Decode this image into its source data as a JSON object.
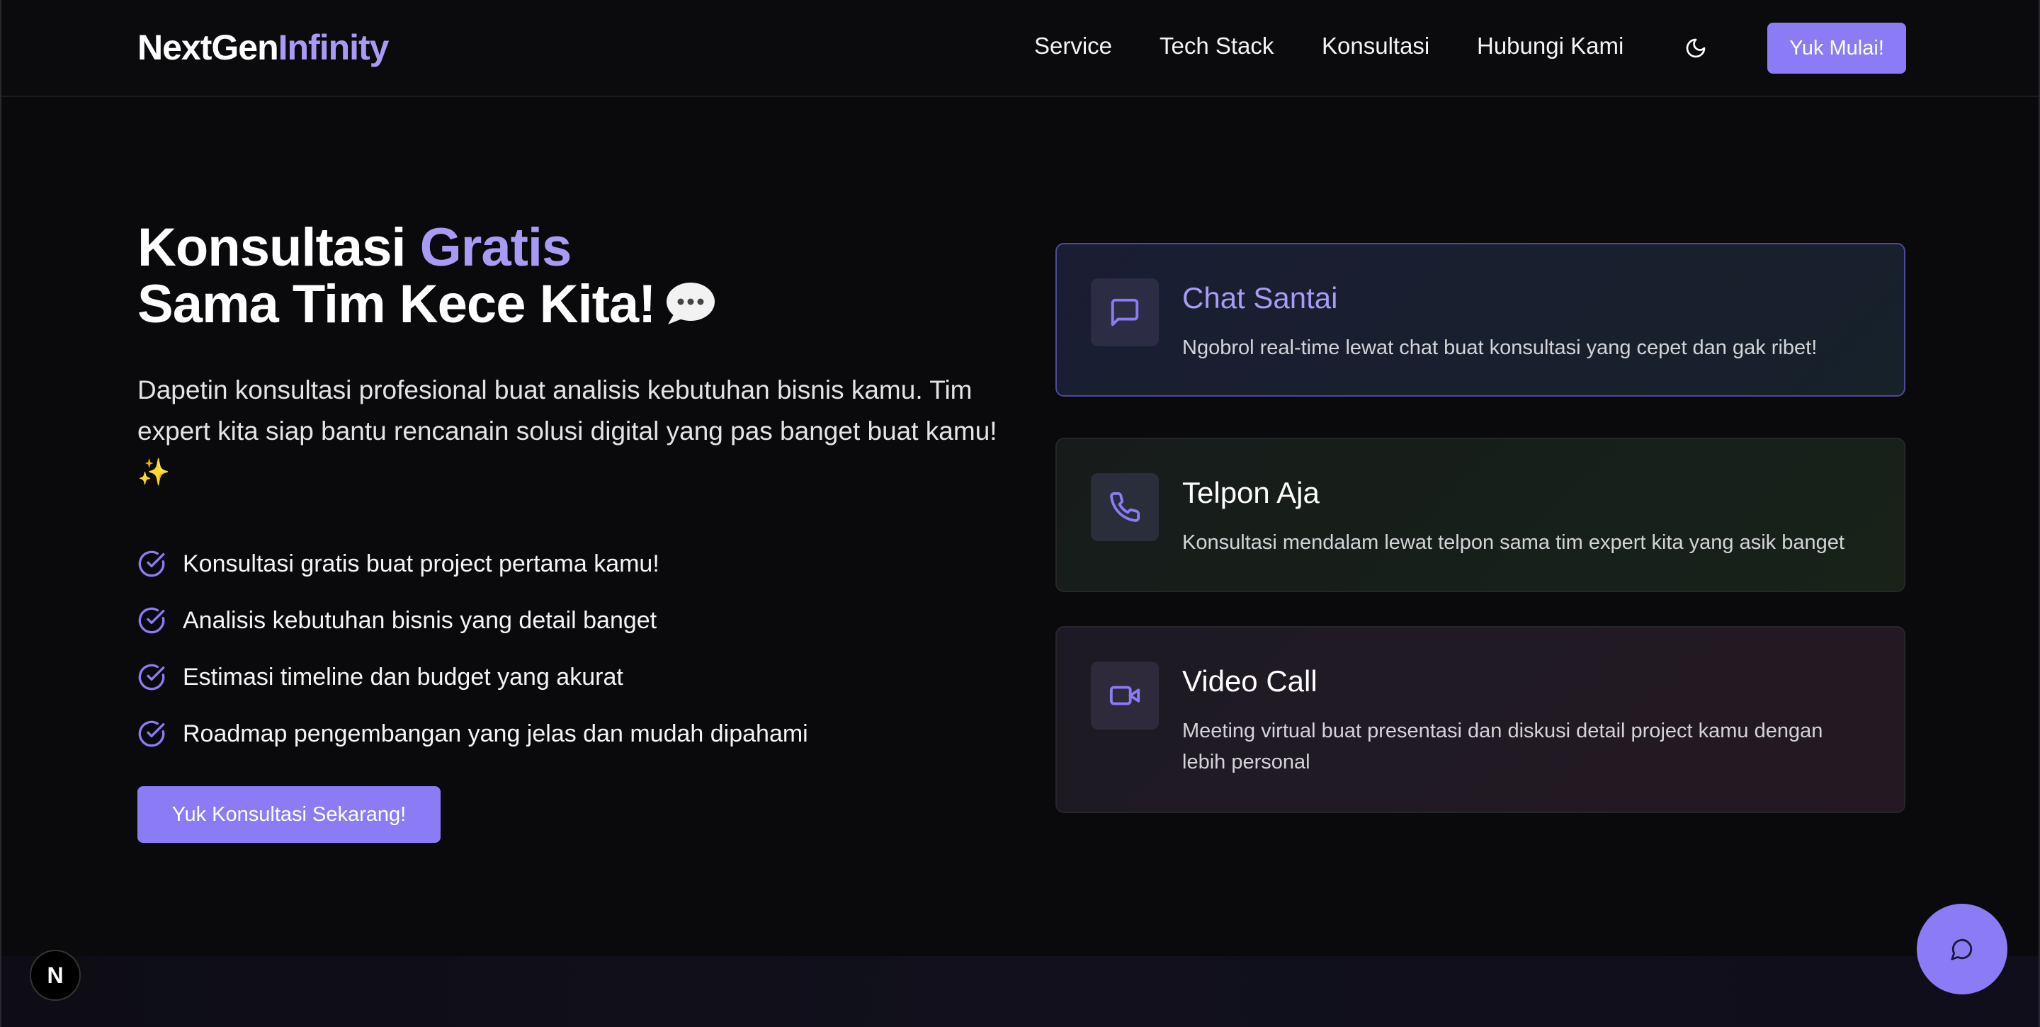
{
  "brand": {
    "part1": "NextGen",
    "part2": "Infinity"
  },
  "nav": {
    "links": [
      "Service",
      "Tech Stack",
      "Konsultasi",
      "Hubungi Kami"
    ],
    "theme_icon": "moon-icon",
    "cta": "Yuk Mulai!"
  },
  "hero": {
    "title_line1_a": "Konsultasi ",
    "title_line1_b": "Gratis",
    "title_line2": "Sama Tim Kece Kita!",
    "description": "Dapetin konsultasi profesional buat analisis kebutuhan bisnis kamu. Tim expert kita siap bantu rencanain solusi digital yang pas banget buat kamu! ✨",
    "checklist": [
      "Konsultasi gratis buat project pertama kamu!",
      "Analisis kebutuhan bisnis yang detail banget",
      "Estimasi timeline dan budget yang akurat",
      "Roadmap pengembangan yang jelas dan mudah dipahami"
    ],
    "cta": "Yuk Konsultasi Sekarang!"
  },
  "cards": [
    {
      "title": "Chat Santai",
      "desc": "Ngobrol real-time lewat chat buat konsultasi yang cepet dan gak ribet!",
      "icon": "chat-icon"
    },
    {
      "title": "Telpon Aja",
      "desc": "Konsultasi mendalam lewat telpon sama tim expert kita yang asik banget",
      "icon": "phone-icon"
    },
    {
      "title": "Video Call",
      "desc": "Meeting virtual buat presentasi dan diskusi detail project kamu dengan lebih personal",
      "icon": "video-icon"
    }
  ],
  "floaters": {
    "next_badge": "N",
    "fab_icon": "chat-bubble-icon"
  },
  "colors": {
    "accent": "#8b7cf6",
    "accent_text": "#a89bf5",
    "background": "#0a0a0c"
  }
}
